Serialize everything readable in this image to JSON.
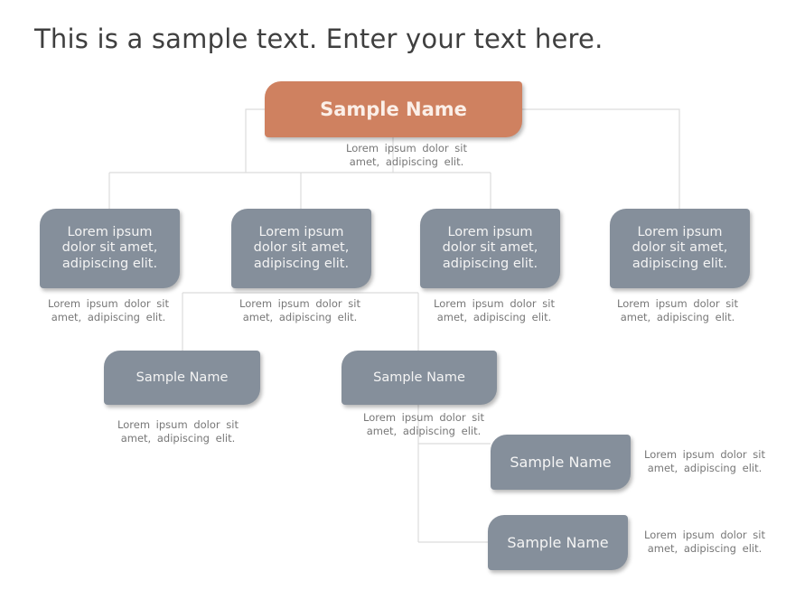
{
  "title": "This is a sample text. Enter your text here.",
  "root": {
    "label": "Sample Name",
    "desc": [
      "Lorem ipsum dolor sit",
      "amet, adipiscing elit."
    ]
  },
  "level1": [
    {
      "label": [
        "Lorem ipsum",
        "dolor sit amet,",
        "adipiscing elit."
      ],
      "desc": [
        "Lorem ipsum dolor sit",
        "amet, adipiscing elit."
      ]
    },
    {
      "label": [
        "Lorem ipsum",
        "dolor sit amet,",
        "adipiscing elit."
      ],
      "desc": [
        "Lorem ipsum dolor sit",
        "amet, adipiscing elit."
      ]
    },
    {
      "label": [
        "Lorem ipsum",
        "dolor sit amet,",
        "adipiscing elit."
      ],
      "desc": [
        "Lorem ipsum dolor sit",
        "amet, adipiscing elit."
      ]
    },
    {
      "label": [
        "Lorem ipsum",
        "dolor sit amet,",
        "adipiscing elit."
      ],
      "desc": [
        "Lorem ipsum dolor sit",
        "amet, adipiscing elit."
      ]
    }
  ],
  "level2": [
    {
      "label": "Sample Name",
      "desc": [
        "Lorem ipsum dolor sit",
        "amet, adipiscing elit."
      ]
    },
    {
      "label": "Sample Name",
      "desc": [
        "Lorem ipsum dolor sit",
        "amet, adipiscing elit."
      ]
    }
  ],
  "level3": [
    {
      "label": "Sample Name",
      "desc": [
        "Lorem ipsum dolor sit",
        "amet, adipiscing elit."
      ]
    },
    {
      "label": "Sample Name",
      "desc": [
        "Lorem ipsum dolor sit",
        "amet, adipiscing elit."
      ]
    }
  ],
  "colors": {
    "root": "#cf8160",
    "node": "#858f9b",
    "connector": "#dcdcdc",
    "desc_text": "#777777"
  }
}
